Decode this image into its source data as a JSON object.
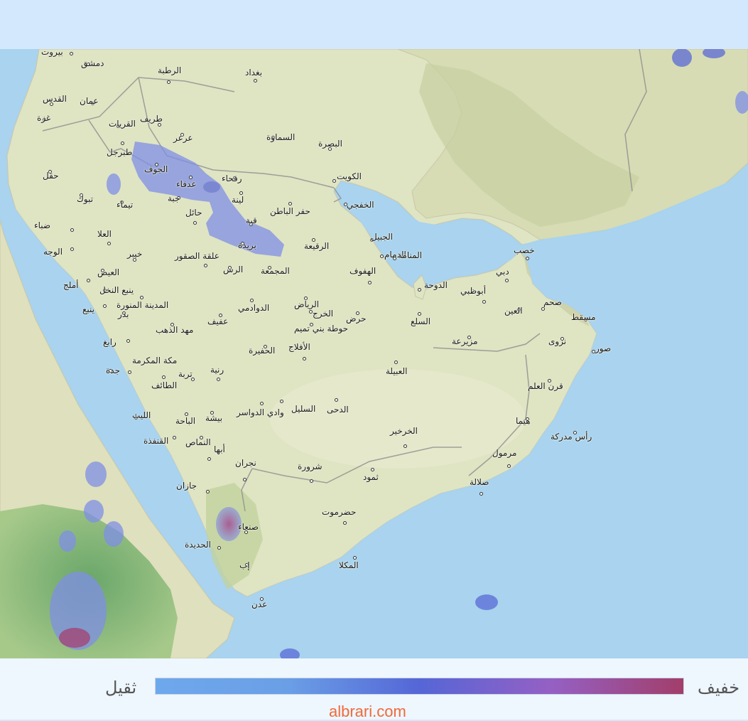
{
  "legend": {
    "heavy_label": "ثقيل",
    "light_label": "خفيف",
    "gradient_colors": [
      "#6ea8ec",
      "#6a9fe6",
      "#5566d6",
      "#9560c4",
      "#a23e6a"
    ]
  },
  "credit": "albrari.com",
  "colors": {
    "sea": "#a9d3ee",
    "land": "#dfe4c3",
    "green_land": "#8fbf7c",
    "border": "#9a9a9a",
    "rain_light": "#7f8fe6",
    "rain_heavy": "#a0368a"
  },
  "cities": [
    {
      "name": "بيروت"
    },
    {
      "name": "دمشق"
    },
    {
      "name": "القدس"
    },
    {
      "name": "عمان"
    },
    {
      "name": "غزة"
    },
    {
      "name": "الرطبة"
    },
    {
      "name": "بغداد"
    },
    {
      "name": "طريف"
    },
    {
      "name": "القريات"
    },
    {
      "name": "عرعر"
    },
    {
      "name": "السماوة"
    },
    {
      "name": "البصرة"
    },
    {
      "name": "طبرجل"
    },
    {
      "name": "الجوف"
    },
    {
      "name": "حقل"
    },
    {
      "name": "عدفاء"
    },
    {
      "name": "رفحاء"
    },
    {
      "name": "الكويت"
    },
    {
      "name": "تبوك"
    },
    {
      "name": "تيماء"
    },
    {
      "name": "جبة"
    },
    {
      "name": "لينة"
    },
    {
      "name": "حائل"
    },
    {
      "name": "حفر الباطن"
    },
    {
      "name": "الخفجي"
    },
    {
      "name": "ضباء"
    },
    {
      "name": "قبة"
    },
    {
      "name": "العلا"
    },
    {
      "name": "الجبيل"
    },
    {
      "name": "بريدة"
    },
    {
      "name": "الرقيعة"
    },
    {
      "name": "الوجه"
    },
    {
      "name": "خيبر"
    },
    {
      "name": "علقة الصقور"
    },
    {
      "name": "الدمام"
    },
    {
      "name": "المنامة"
    },
    {
      "name": "خصب"
    },
    {
      "name": "العيص"
    },
    {
      "name": "الرس"
    },
    {
      "name": "المجمعة"
    },
    {
      "name": "الهفوف"
    },
    {
      "name": "دبي"
    },
    {
      "name": "أملج"
    },
    {
      "name": "ينبع النخل"
    },
    {
      "name": "الدوحة"
    },
    {
      "name": "أبوظبي"
    },
    {
      "name": "المدينة المنورة"
    },
    {
      "name": "الرياض"
    },
    {
      "name": "صحم"
    },
    {
      "name": "ينبع"
    },
    {
      "name": "بدر"
    },
    {
      "name": "الدوادمي"
    },
    {
      "name": "الخرج"
    },
    {
      "name": "العين"
    },
    {
      "name": "مسقط"
    },
    {
      "name": "عفيف"
    },
    {
      "name": "حرض"
    },
    {
      "name": "السلع"
    },
    {
      "name": "مهد الذهب"
    },
    {
      "name": "حوطة بني تميم"
    },
    {
      "name": "رابغ"
    },
    {
      "name": "الأفلاج"
    },
    {
      "name": "مزيرعة"
    },
    {
      "name": "نزوى"
    },
    {
      "name": "صور"
    },
    {
      "name": "الحفيرة"
    },
    {
      "name": "مكة المكرمة"
    },
    {
      "name": "جدة"
    },
    {
      "name": "رنية"
    },
    {
      "name": "تربة"
    },
    {
      "name": "العبيلة"
    },
    {
      "name": "الطائف"
    },
    {
      "name": "قرن العلم"
    },
    {
      "name": "الدحى"
    },
    {
      "name": "السليل"
    },
    {
      "name": "وادي الدواسر"
    },
    {
      "name": "الليث"
    },
    {
      "name": "بيشة"
    },
    {
      "name": "الباحة"
    },
    {
      "name": "هيما"
    },
    {
      "name": "الخرخير"
    },
    {
      "name": "رأس مدركة"
    },
    {
      "name": "القنفذة"
    },
    {
      "name": "النماص"
    },
    {
      "name": "أبها"
    },
    {
      "name": "مرمول"
    },
    {
      "name": "نجران"
    },
    {
      "name": "شرورة"
    },
    {
      "name": "ثمود"
    },
    {
      "name": "صلالة"
    },
    {
      "name": "جازان"
    },
    {
      "name": "حضرموت"
    },
    {
      "name": "صنعاء"
    },
    {
      "name": "الحديدة"
    },
    {
      "name": "إب"
    },
    {
      "name": "المكلا"
    },
    {
      "name": "عدن"
    }
  ]
}
